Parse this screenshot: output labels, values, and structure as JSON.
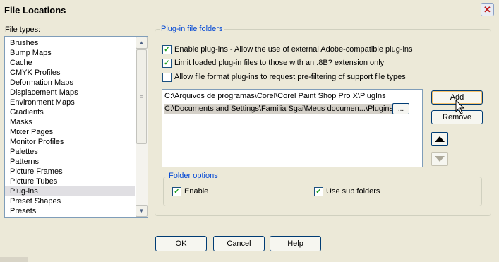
{
  "window": {
    "title": "File Locations",
    "close_symbol": "✕"
  },
  "file_types": {
    "label": "File types:",
    "items": [
      "Brushes",
      "Bump Maps",
      "Cache",
      "CMYK Profiles",
      "Deformation Maps",
      "Displacement Maps",
      "Environment Maps",
      "Gradients",
      "Masks",
      "Mixer Pages",
      "Monitor Profiles",
      "Palettes",
      "Patterns",
      "Picture Frames",
      "Picture Tubes",
      "Plug-ins",
      "Preset Shapes",
      "Presets"
    ],
    "selected_index": 15
  },
  "plugin_group": {
    "legend": "Plug-in file folders",
    "options": [
      {
        "label": "Enable plug-ins - Allow the use of external Adobe-compatible plug-ins",
        "checked": true
      },
      {
        "label": "Limit loaded plug-in files to those with an .8B? extension only",
        "checked": true
      },
      {
        "label": "Allow file format plug-ins to request pre-filtering of support file types",
        "checked": false
      }
    ],
    "paths": [
      "C:\\Arquivos de programas\\Corel\\Corel Paint Shop Pro X\\PlugIns",
      "C:\\Documents and Settings\\Familia Sgai\\Meus documen...\\Plugins"
    ],
    "browse_label": "...",
    "add_label": "Add",
    "remove_label": "Remove"
  },
  "folder_options": {
    "legend": "Folder options",
    "enable_label": "Enable",
    "enable_checked": true,
    "subfolders_label": "Use sub folders",
    "subfolders_checked": true
  },
  "buttons": {
    "ok": "OK",
    "cancel": "Cancel",
    "help": "Help"
  },
  "check_glyph": "✓",
  "colors": {
    "dialog_bg": "#ece9d8",
    "group_legend": "#0046d5",
    "close_icon": "#c01818"
  }
}
